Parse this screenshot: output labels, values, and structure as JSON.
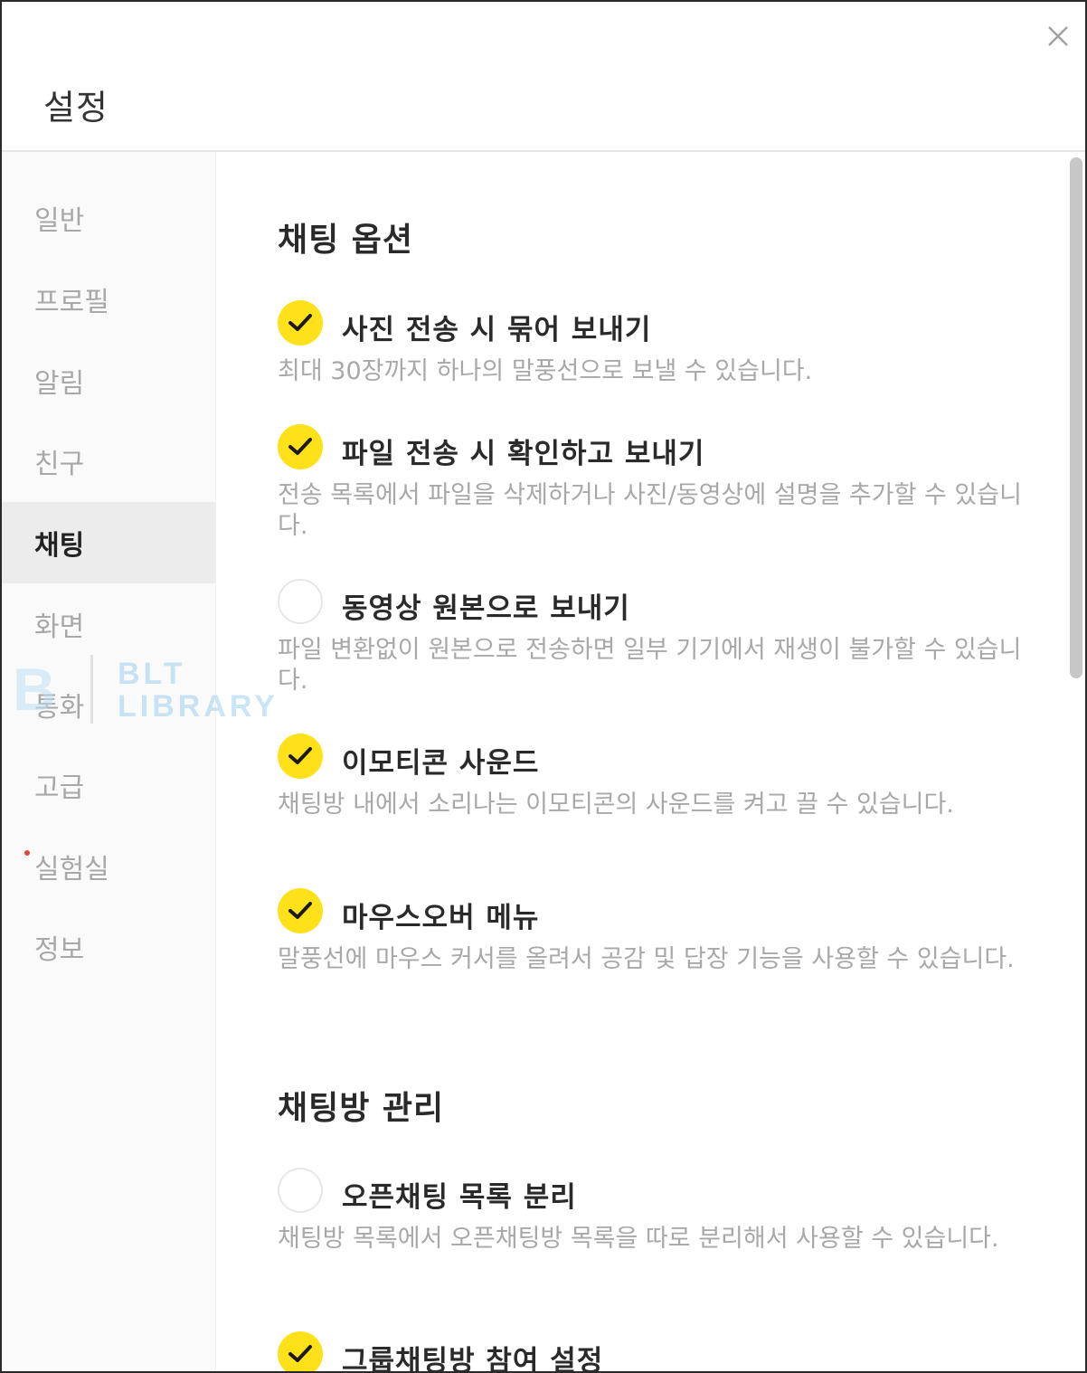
{
  "window": {
    "title": "설정"
  },
  "sidebar": {
    "items": [
      {
        "label": "일반"
      },
      {
        "label": "프로필"
      },
      {
        "label": "알림"
      },
      {
        "label": "친구"
      },
      {
        "label": "채팅",
        "active": true
      },
      {
        "label": "화면"
      },
      {
        "label": "통화"
      },
      {
        "label": "고급"
      },
      {
        "label": "실험실",
        "badge": "new-dot"
      },
      {
        "label": "정보"
      }
    ]
  },
  "content": {
    "chat_options": {
      "title": "채팅 옵션",
      "options": [
        {
          "label": "사진 전송 시 묶어 보내기",
          "checked": true,
          "desc": "최대 30장까지 하나의 말풍선으로 보낼 수 있습니다."
        },
        {
          "label": "파일 전송 시 확인하고 보내기",
          "checked": true,
          "desc": "전송 목록에서 파일을 삭제하거나 사진/동영상에 설명을 추가할 수 있습니다."
        },
        {
          "label": "동영상 원본으로 보내기",
          "checked": false,
          "desc": "파일 변환없이 원본으로 전송하면 일부 기기에서 재생이 불가할 수 있습니다."
        },
        {
          "label": "이모티콘 사운드",
          "checked": true,
          "desc": "채팅방 내에서 소리나는 이모티콘의 사운드를 켜고 끌 수 있습니다."
        },
        {
          "label": "마우스오버 메뉴",
          "checked": true,
          "desc": "말풍선에 마우스 커서를 올려서 공감 및 답장 기능을 사용할 수 있습니다."
        }
      ]
    },
    "chatroom_management": {
      "title": "채팅방 관리",
      "options": [
        {
          "label": "오픈채팅 목록 분리",
          "checked": false,
          "desc": "채팅방 목록에서 오픈채팅방 목록을 따로 분리해서 사용할 수 있습니다."
        },
        {
          "label": "그룹채팅방 참여 설정",
          "checked": true,
          "desc": ""
        }
      ]
    }
  },
  "watermark": {
    "mark": "B",
    "line1": "BLT",
    "line2": "LIBRARY"
  },
  "colors": {
    "accent": "#ffe11a",
    "muted_text": "#a8a8a8",
    "active_nav_bg": "#ececec"
  },
  "icons": {
    "close": "close-icon",
    "check": "check-icon"
  }
}
